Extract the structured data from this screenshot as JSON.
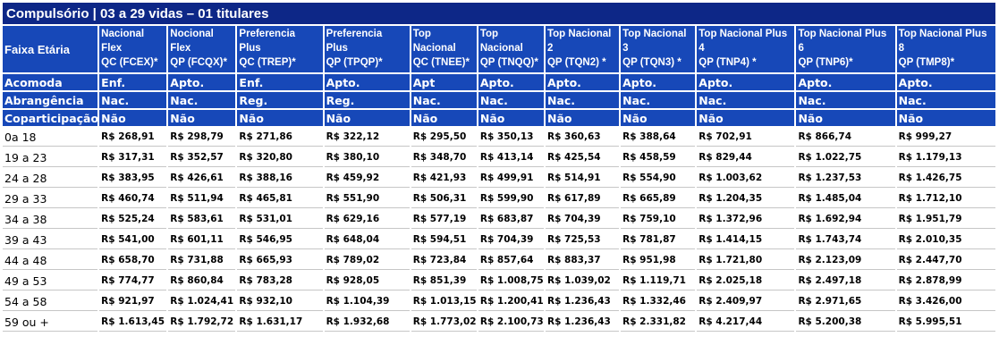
{
  "title": "Compulsório | 03 a 29 vidas – 01 titulares",
  "header": {
    "label": "Faixa Etária",
    "plans": [
      {
        "line1": "Nacional",
        "line2": "Flex",
        "line3": "QC (FCEX)*"
      },
      {
        "line1": "Nocional",
        "line2": "Flex",
        "line3": "QP (FCQX)*"
      },
      {
        "line1": "Preferencia",
        "line2": "Plus",
        "line3": "QC (TREP)*"
      },
      {
        "line1": "Preferencia",
        "line2": "Plus",
        "line3": "QP (TPQP)*"
      },
      {
        "line1": "Top",
        "line2": "Nacional",
        "line3": "QC (TNEE)*"
      },
      {
        "line1": "Top",
        "line2": "Nacional",
        "line3": "QP (TNQQ)*"
      },
      {
        "line1": "Top Nacional",
        "line2": "2",
        "line3": "QP (TQN2) *"
      },
      {
        "line1": "Top Nacional",
        "line2": "3",
        "line3": "QP (TQN3) *"
      },
      {
        "line1": "Top Nacional Plus",
        "line2": "4",
        "line3": "QP (TNP4) *"
      },
      {
        "line1": "Top Nacional Plus",
        "line2": "6",
        "line3": "QP (TNP6)*"
      },
      {
        "line1": "Top Nacional Plus",
        "line2": "8",
        "line3": "QP (TMP8)*"
      }
    ]
  },
  "attributes": [
    {
      "label": "Acomoda",
      "values": [
        "Enf.",
        "Apto.",
        "Enf.",
        "Apto.",
        "Apt",
        "Apto.",
        "Apto.",
        "Apto.",
        "Apto.",
        "Apto.",
        "Apto."
      ]
    },
    {
      "label": "Abrangência",
      "values": [
        "Nac.",
        "Nac.",
        "Reg.",
        "Reg.",
        "Nac.",
        "Nac.",
        "Nac.",
        "Nac.",
        "Nac.",
        "Nac.",
        "Nac."
      ]
    },
    {
      "label": "Coparticipação",
      "values": [
        "Não",
        "Não",
        "Não",
        "Não",
        "Não",
        "Não",
        "Não",
        "Não",
        "Não",
        "Não",
        "Não"
      ]
    }
  ],
  "rows": [
    {
      "age": "0a 18",
      "prices": [
        "R$  268,91",
        "R$ 298,79",
        "R$  271,86",
        "R$ 322,12",
        "R$ 295,50",
        "R$ 350,13",
        "R$ 360,63",
        "R$ 388,64",
        "R$ 702,91",
        "R$ 866,74",
        "R$ 999,27"
      ]
    },
    {
      "age": "19 a 23",
      "prices": [
        "R$ 317,31",
        "R$ 352,57",
        "R$ 320,80",
        "R$ 380,10",
        "R$ 348,70",
        "R$ 413,14",
        "R$ 425,54",
        "R$ 458,59",
        "R$ 829,44",
        "R$ 1.022,75",
        "R$ 1.179,13"
      ]
    },
    {
      "age": "24 a 28",
      "prices": [
        "R$ 383,95",
        "R$ 426,61",
        "R$ 388,16",
        "R$ 459,92",
        "R$ 421,93",
        "R$ 499,91",
        "R$ 514,91",
        "R$ 554,90",
        "R$ 1.003,62",
        "R$ 1.237,53",
        "R$ 1.426,75"
      ]
    },
    {
      "age": "29 a 33",
      "prices": [
        "R$ 460,74",
        "R$ 511,94",
        "R$ 465,81",
        "R$ 551,90",
        "R$ 506,31",
        "R$ 599,90",
        "R$ 617,89",
        "R$ 665,89",
        "R$ 1.204,35",
        "R$ 1.485,04",
        "R$ 1.712,10"
      ]
    },
    {
      "age": "34 a 38",
      "prices": [
        "R$ 525,24",
        "R$ 583,61",
        "R$ 531,01",
        "R$ 629,16",
        "R$ 577,19",
        "R$ 683,87",
        "R$ 704,39",
        "R$ 759,10",
        "R$ 1.372,96",
        "R$ 1.692,94",
        "R$ 1.951,79"
      ]
    },
    {
      "age": "39 a 43",
      "prices": [
        "R$ 541,00",
        "R$ 601,11",
        "R$ 546,95",
        "R$ 648,04",
        "R$ 594,51",
        "R$ 704,39",
        "R$ 725,53",
        "R$ 781,87",
        "R$ 1.414,15",
        "R$ 1.743,74",
        "R$ 2.010,35"
      ]
    },
    {
      "age": "44 a 48",
      "prices": [
        "R$ 658,70",
        "R$ 731,88",
        "R$ 665,93",
        "R$ 789,02",
        "R$ 723,84",
        "R$ 857,64",
        "R$ 883,37",
        "R$ 951,98",
        "R$ 1.721,80",
        "R$ 2.123,09",
        "R$ 2.447,70"
      ]
    },
    {
      "age": "49 a 53",
      "prices": [
        "R$ 774,77",
        "R$ 860,84",
        "R$ 783,28",
        "R$ 928,05",
        "R$ 851,39",
        "R$ 1.008,75",
        "R$ 1.039,02",
        "R$ 1.119,71",
        "R$ 2.025,18",
        "R$ 2.497,18",
        "R$ 2.878,99"
      ]
    },
    {
      "age": "54 a 58",
      "prices": [
        "R$ 921,97",
        "R$ 1.024,41",
        "R$ 932,10",
        "R$ 1.104,39",
        "R$ 1.013,15",
        "R$ 1.200,41",
        "R$ 1.236,43",
        "R$ 1.332,46",
        "R$ 2.409,97",
        "R$ 2.971,65",
        "R$ 3.426,00"
      ]
    },
    {
      "age": "59 ou +",
      "prices": [
        "R$ 1.613,45",
        "R$ 1.792,72",
        "R$ 1.631,17",
        "R$ 1.932,68",
        "R$ 1.773,02",
        "R$ 2.100,73",
        "R$ 1.236,43",
        "R$ 2.331,82",
        "R$ 4.217,44",
        "R$ 5.200,38",
        "R$ 5.995,51"
      ]
    }
  ]
}
